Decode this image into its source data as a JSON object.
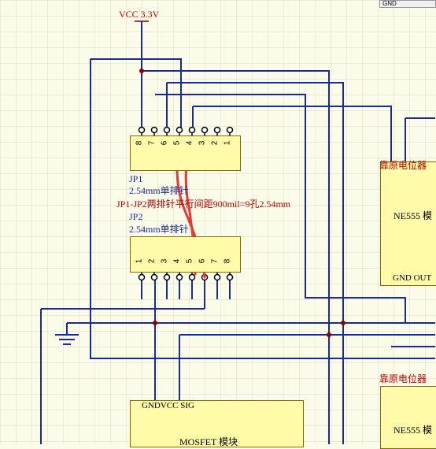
{
  "power": {
    "vcc_label": "VCC 3.3V"
  },
  "jp1": {
    "designator": "JP1",
    "comment": "2.54mm单排针",
    "pins": [
      "8",
      "7",
      "6",
      "5",
      "4",
      "3",
      "2",
      "1"
    ]
  },
  "jp2": {
    "designator": "JP2",
    "comment": "2.54mm单排针",
    "pins": [
      "1",
      "2",
      "3",
      "4",
      "5",
      "6",
      "7",
      "8"
    ]
  },
  "note": "JP1-JP2两排针平行间距900mil=9孔2.54mm",
  "modules": {
    "ne555_top": {
      "header": "靠原电位器",
      "name": "NE555 模",
      "pins": "GND OUT"
    },
    "ne555_bottom": {
      "header": "靠原电位器",
      "name": "NE555 模"
    },
    "mosfet": {
      "pins": "GNDVCC SIG",
      "name": "MOSFET 模块"
    }
  },
  "corner_tag": "GND",
  "colors": {
    "background": "#fbfbe9",
    "grid": "#dcdcc4",
    "wire": "#1a2a9c",
    "component_fill": "#fffba8",
    "label_red": "#c00000",
    "annotation": "#e53935"
  }
}
